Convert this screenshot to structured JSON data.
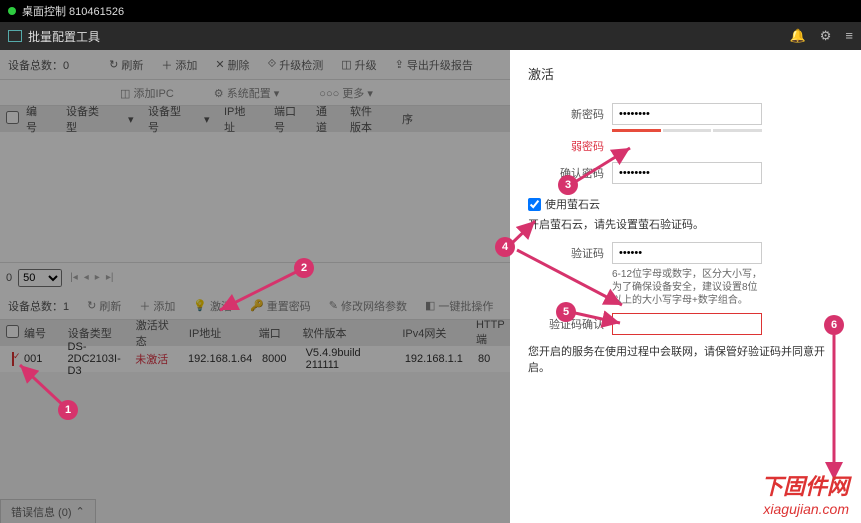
{
  "titlebar": "桌面控制 810461526",
  "app_title": "批量配置工具",
  "header_icons": {
    "bell": "🔔",
    "gear": "⚙",
    "bars": "≡"
  },
  "tb1": {
    "count_label": "设备总数：",
    "count": "0",
    "refresh": "刷新",
    "add": "添加",
    "delete": "删除",
    "upgrade_check": "升级检测",
    "upgrade": "升级",
    "export": "导出升级报告"
  },
  "tb2": {
    "add_ipc": "添加IPC",
    "system_config": "系统配置",
    "more": "更多"
  },
  "head1": {
    "c1": "编号",
    "c2": "设备类型",
    "c3": "设备型号",
    "c4": "IP地址",
    "c5": "端口号",
    "c6": "通道",
    "c7": "软件版本",
    "c8": "序"
  },
  "pager": {
    "zero": "0",
    "size": "50"
  },
  "tb3": {
    "count_label": "设备总数：",
    "count": "1",
    "refresh": "刷新",
    "add": "添加",
    "activate": "激活",
    "reset_pwd": "重置密码",
    "edit_net": "修改网络参数",
    "onekey": "一键批操作"
  },
  "head2": {
    "c1": "编号",
    "c2": "设备类型",
    "c3": "激活状态",
    "c4": "IP地址",
    "c5": "端口",
    "c6": "软件版本",
    "c7": "IPv4网关",
    "c8": "HTTP端"
  },
  "row": {
    "idx": "001",
    "type": "DS-2DC2103I-D3",
    "status": "未激活",
    "ip": "192.168.1.64",
    "port": "8000",
    "ver": "V5.4.9build 211111",
    "gw": "192.168.1.1",
    "http": "80"
  },
  "bottom_tab": "错误信息 (0)",
  "panel": {
    "title": "激活",
    "new_pwd": "新密码",
    "weak_label": "弱密码",
    "confirm_pwd": "确认密码",
    "ezviz": "使用萤石云",
    "ezviz_hint": "开启萤石云，请先设置萤石验证码。",
    "verify": "验证码",
    "verify_hint": "6-12位字母或数字，区分大小写，为了确保设备安全，建议设置8位以上的大小写字母+数字组合。",
    "verify_confirm": "验证码确认",
    "note": "您开启的服务在使用过程中会联网，请保管好验证码并同意开启。"
  },
  "watermark": {
    "l1": "下固件网",
    "l2": "xiagujian.com"
  },
  "markers": {
    "m1": "1",
    "m2": "2",
    "m3": "3",
    "m4": "4",
    "m5": "5",
    "m6": "6"
  }
}
